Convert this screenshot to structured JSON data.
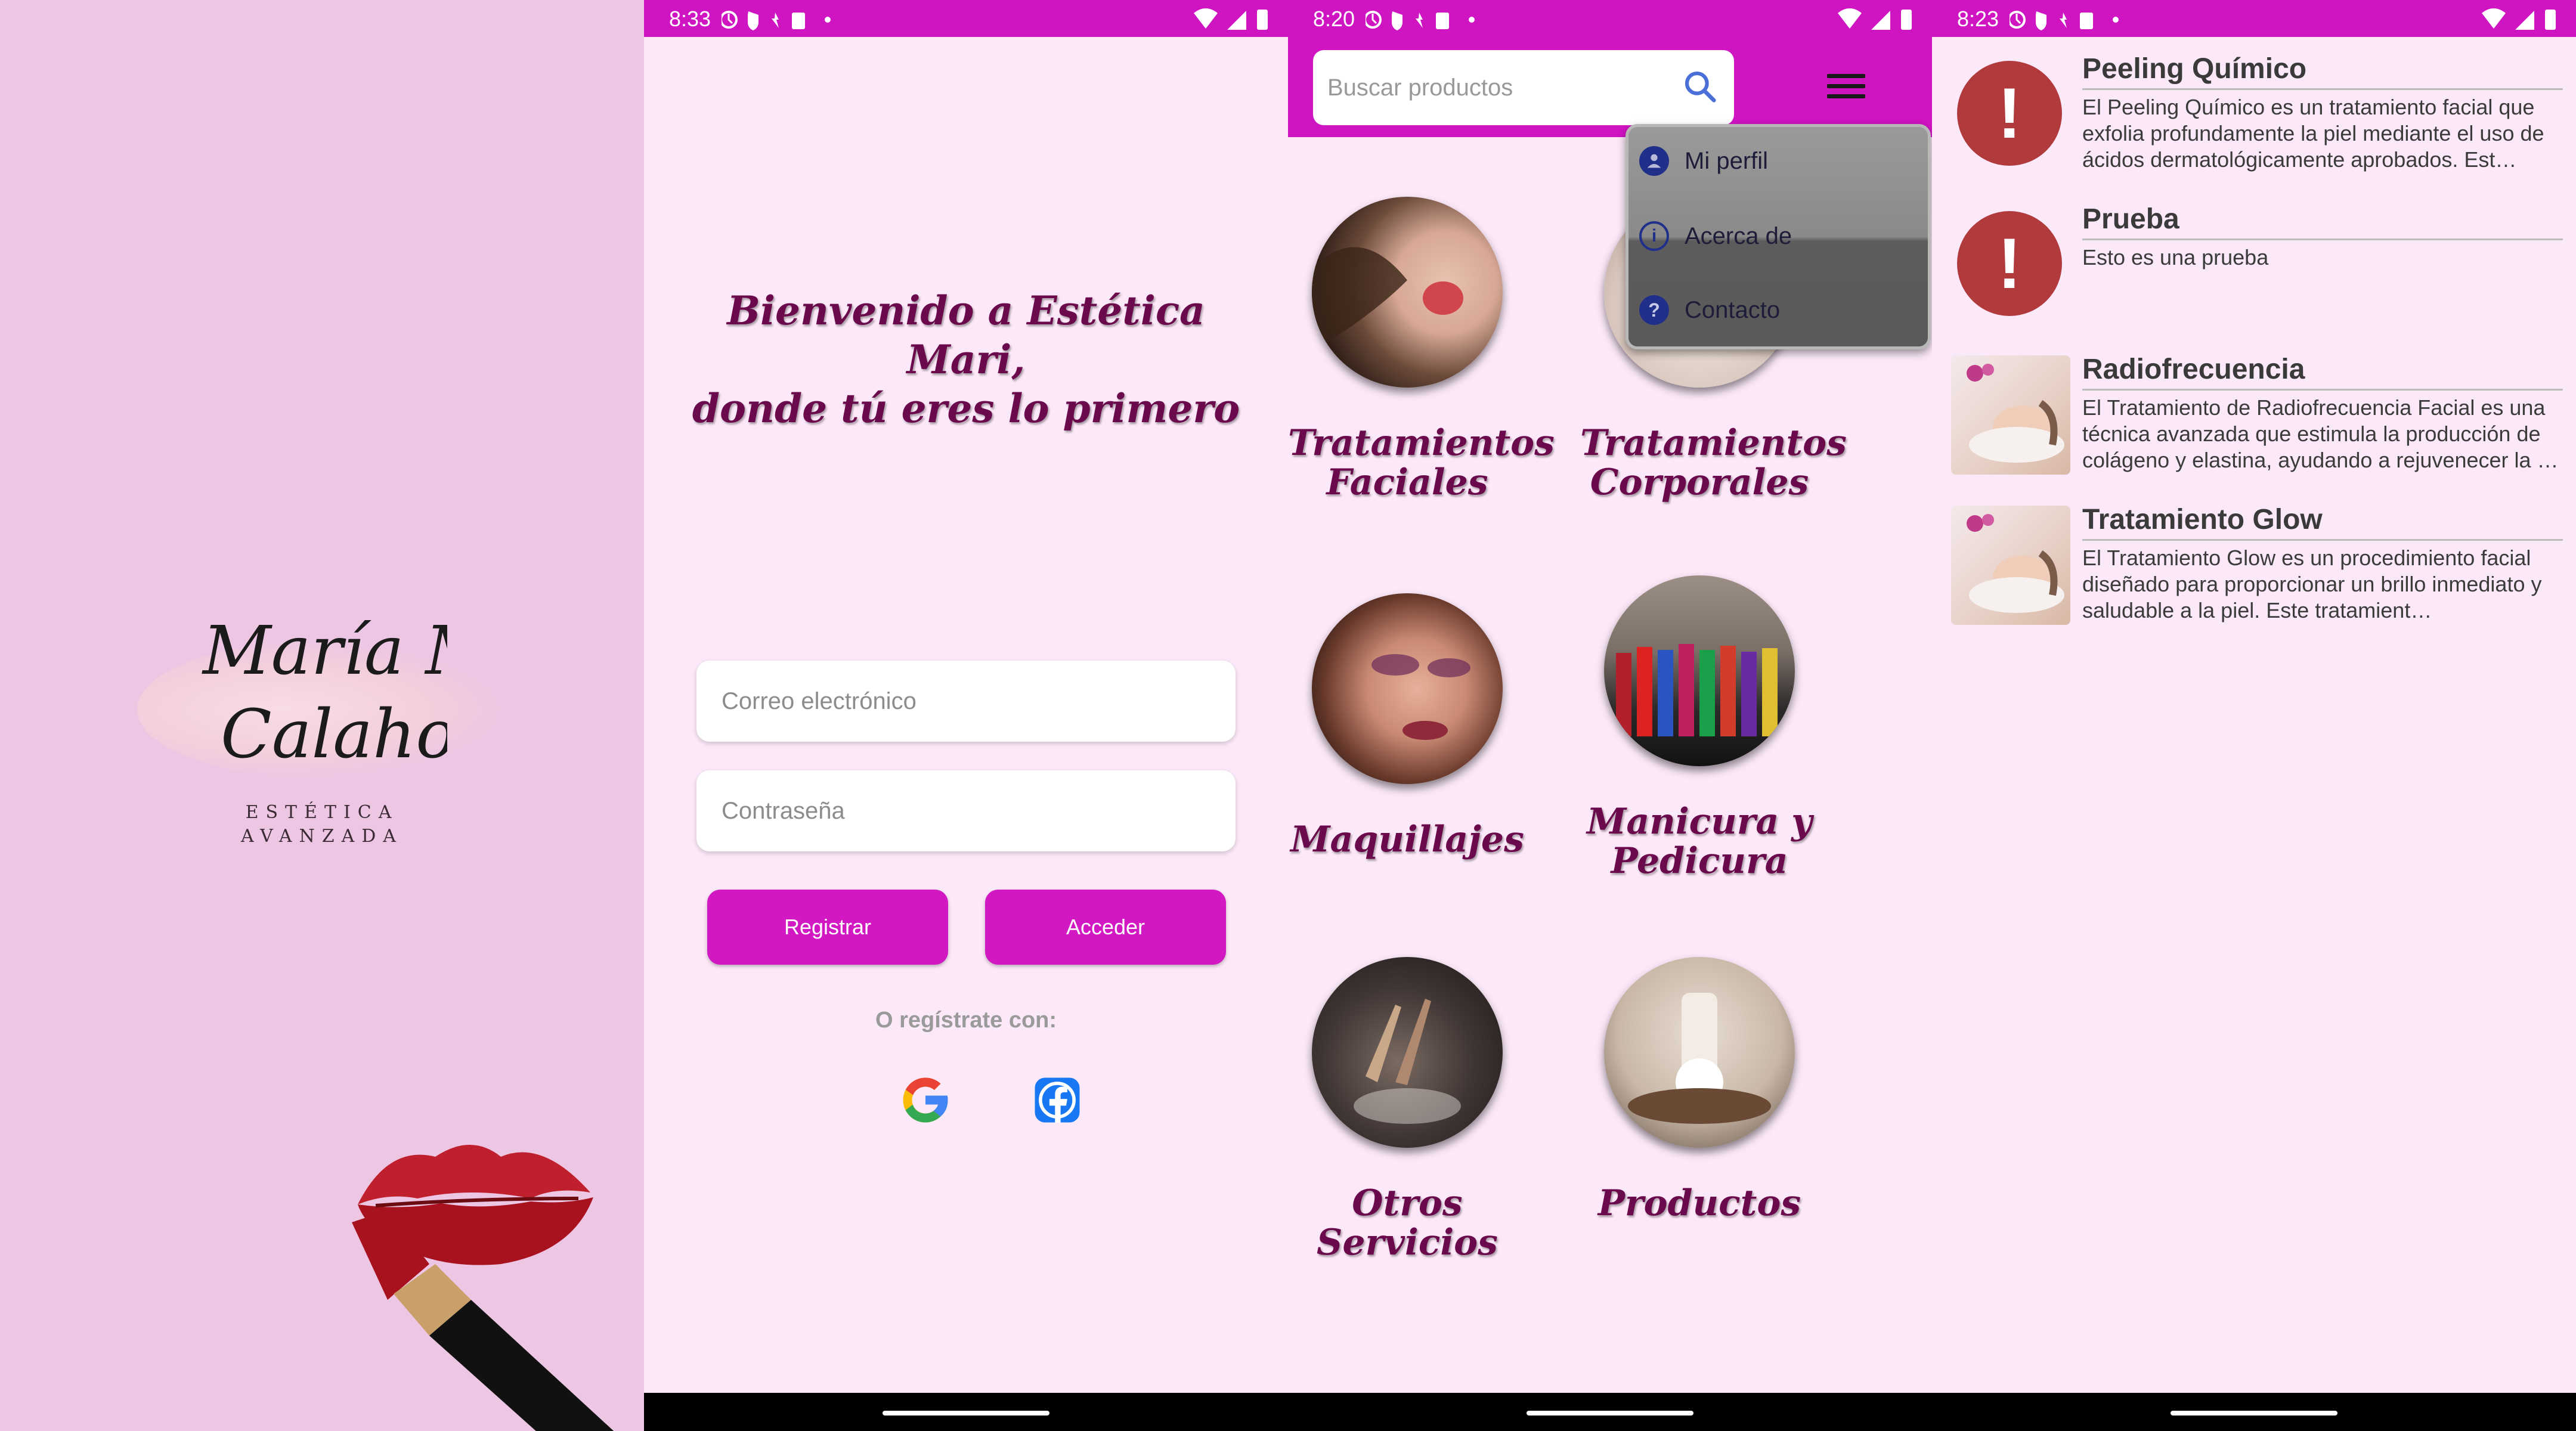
{
  "splash": {
    "logo_line1": "María M.",
    "logo_line2": "Calahorro",
    "subtitle_line1": "ESTÉTICA",
    "subtitle_line2": "AVANZADA"
  },
  "status_times": [
    "8:33",
    "8:20",
    "8:23"
  ],
  "login": {
    "welcome_line1": "Bienvenido a Estética Mari,",
    "welcome_line2": "donde tú eres lo primero",
    "email_placeholder": "Correo electrónico",
    "password_placeholder": "Contraseña",
    "register_label": "Registrar",
    "login_label": "Acceder",
    "social_text": "O regístrate con:"
  },
  "home": {
    "search_placeholder": "Buscar productos",
    "menu": [
      {
        "label": "Mi perfil",
        "icon": "person-icon"
      },
      {
        "label": "Acerca de",
        "icon": "info-icon"
      },
      {
        "label": "Contacto",
        "icon": "help-icon"
      }
    ],
    "categories": [
      {
        "line1": "Tratamientos",
        "line2": "Faciales"
      },
      {
        "line1": "Tratamientos",
        "line2": "Corporales"
      },
      {
        "line1": "Maquillajes",
        "line2": ""
      },
      {
        "line1": "Manicura y",
        "line2": "Pedicura"
      },
      {
        "line1": "Otros Servicios",
        "line2": ""
      },
      {
        "line1": "Productos",
        "line2": ""
      }
    ]
  },
  "list": {
    "items": [
      {
        "title": "Peeling Químico",
        "description": "El Peeling Químico es un tratamiento facial que exfolia profundamente la piel mediante el uso de ácidos dermatológicamente aprobados. Est…",
        "thumb": "alert-icon"
      },
      {
        "title": "Prueba",
        "description": "Esto es una prueba",
        "thumb": "alert-icon"
      },
      {
        "title": "Radiofrecuencia",
        "description": "El Tratamiento de Radiofrecuencia Facial es una técnica avanzada que estimula la producción de colágeno y elastina, ayudando a rejuvenecer la …",
        "thumb": "facial-photo"
      },
      {
        "title": "Tratamiento Glow",
        "description": "El Tratamiento Glow es un procedimiento facial diseñado para proporcionar un brillo inmediato y saludable a la piel. Este tratamient…",
        "thumb": "facial-photo"
      }
    ]
  },
  "colors": {
    "accent": "#cf14c2",
    "background": "#fbe8f8",
    "splash_bg": "#ecc6e3",
    "script_text": "#6a0a4c",
    "alert_red": "#b03a3c"
  }
}
